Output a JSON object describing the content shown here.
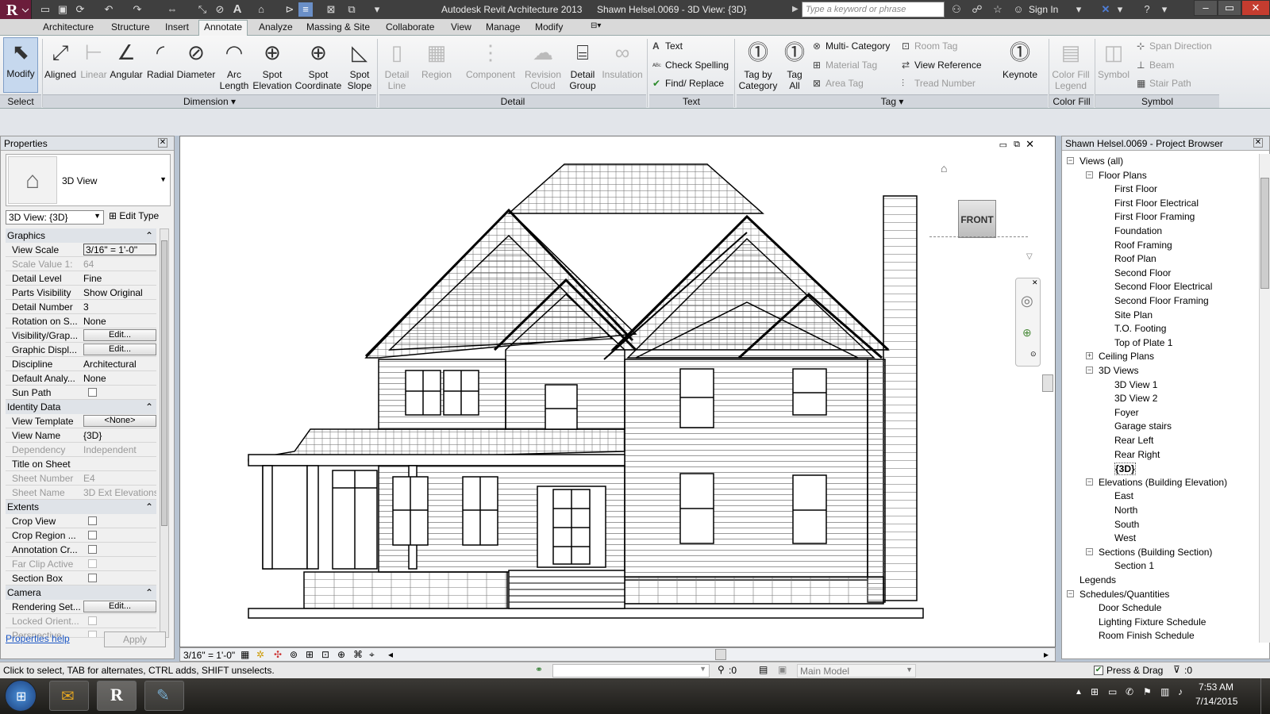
{
  "title": {
    "app": "Autodesk Revit Architecture 2013",
    "doc": "Shawn Helsel.0069 - 3D View: {3D}",
    "search_placeholder": "Type a keyword or phrase",
    "sign_in": "Sign In"
  },
  "tabs": [
    "Architecture",
    "Structure",
    "Insert",
    "Annotate",
    "Analyze",
    "Massing & Site",
    "Collaborate",
    "View",
    "Manage",
    "Modify"
  ],
  "active_tab": "Annotate",
  "ribbon": {
    "modify": "Modify",
    "select": "Select",
    "dimension": [
      "Aligned",
      "Linear",
      "Angular",
      "Radial",
      "Diameter",
      "Arc Length",
      "Spot Elevation",
      "Spot Coordinate",
      "Spot Slope"
    ],
    "dimension_label": "Dimension",
    "detail": [
      "Detail Line",
      "Region",
      "Component",
      "Revision Cloud",
      "Detail Group",
      "Insulation"
    ],
    "detail_label": "Detail",
    "text": [
      "Text",
      "Check Spelling",
      "Find/ Replace"
    ],
    "text_label": "Text",
    "tag_big": [
      "Tag by Category",
      "Tag All"
    ],
    "tag_small": [
      "Multi- Category",
      "Material Tag",
      "Area Tag",
      "Room Tag",
      "View Reference",
      "Tread Number"
    ],
    "keynote": "Keynote",
    "tag_label": "Tag",
    "color_fill": "Color Fill Legend",
    "color_fill_label": "Color Fill",
    "symbol": [
      "Symbol",
      "Span Direction",
      "Beam",
      "Stair Path"
    ],
    "symbol_label": "Symbol"
  },
  "properties": {
    "title": "Properties",
    "type": "3D View",
    "selector": "3D View: {3D}",
    "edit_type": "Edit Type",
    "groups": {
      "graphics": "Graphics",
      "identity": "Identity Data",
      "extents": "Extents",
      "camera": "Camera"
    },
    "rows": [
      {
        "k": "View Scale",
        "v": "3/16\" = 1'-0\""
      },
      {
        "k": "Scale Value    1:",
        "v": "64"
      },
      {
        "k": "Detail Level",
        "v": "Fine"
      },
      {
        "k": "Parts Visibility",
        "v": "Show Original"
      },
      {
        "k": "Detail Number",
        "v": "3"
      },
      {
        "k": "Rotation on S...",
        "v": "None"
      },
      {
        "k": "Visibility/Grap...",
        "v": "Edit..."
      },
      {
        "k": "Graphic Displ...",
        "v": "Edit..."
      },
      {
        "k": "Discipline",
        "v": "Architectural"
      },
      {
        "k": "Default Analy...",
        "v": "None"
      },
      {
        "k": "Sun Path",
        "v": ""
      },
      {
        "k": "View Template",
        "v": "<None>"
      },
      {
        "k": "View Name",
        "v": "{3D}"
      },
      {
        "k": "Dependency",
        "v": "Independent"
      },
      {
        "k": "Title on Sheet",
        "v": ""
      },
      {
        "k": "Sheet Number",
        "v": "E4"
      },
      {
        "k": "Sheet Name",
        "v": "3D Ext Elevations"
      },
      {
        "k": "Crop View",
        "v": ""
      },
      {
        "k": "Crop Region ...",
        "v": ""
      },
      {
        "k": "Annotation Cr...",
        "v": ""
      },
      {
        "k": "Far Clip Active",
        "v": ""
      },
      {
        "k": "Section Box",
        "v": ""
      },
      {
        "k": "Rendering Set...",
        "v": "Edit..."
      },
      {
        "k": "Locked Orient...",
        "v": ""
      },
      {
        "k": "Perspective",
        "v": ""
      }
    ],
    "help": "Properties help",
    "apply": "Apply"
  },
  "view": {
    "cube_label": "FRONT",
    "scale": "3/16\" = 1'-0\""
  },
  "browser": {
    "title": "Shawn Helsel.0069 - Project Browser",
    "items": [
      {
        "t": "Views (all)",
        "lvl": 0
      },
      {
        "t": "Floor Plans",
        "lvl": 1
      },
      {
        "t": "First Floor",
        "lvl": 2
      },
      {
        "t": "First Floor Electrical",
        "lvl": 2
      },
      {
        "t": "First Floor Framing",
        "lvl": 2
      },
      {
        "t": "Foundation",
        "lvl": 2
      },
      {
        "t": "Roof Framing",
        "lvl": 2
      },
      {
        "t": "Roof Plan",
        "lvl": 2
      },
      {
        "t": "Second Floor",
        "lvl": 2
      },
      {
        "t": "Second Floor Electrical",
        "lvl": 2
      },
      {
        "t": "Second Floor Framing",
        "lvl": 2
      },
      {
        "t": "Site Plan",
        "lvl": 2
      },
      {
        "t": "T.O. Footing",
        "lvl": 2
      },
      {
        "t": "Top of Plate 1",
        "lvl": 2
      },
      {
        "t": "Ceiling Plans",
        "lvl": 1
      },
      {
        "t": "3D Views",
        "lvl": 1
      },
      {
        "t": "3D View 1",
        "lvl": 2
      },
      {
        "t": "3D View 2",
        "lvl": 2
      },
      {
        "t": "Foyer",
        "lvl": 2
      },
      {
        "t": "Garage stairs",
        "lvl": 2
      },
      {
        "t": "Rear Left",
        "lvl": 2
      },
      {
        "t": "Rear Right",
        "lvl": 2
      },
      {
        "t": "{3D}",
        "lvl": 2
      },
      {
        "t": "Elevations (Building Elevation)",
        "lvl": 1
      },
      {
        "t": "East",
        "lvl": 2
      },
      {
        "t": "North",
        "lvl": 2
      },
      {
        "t": "South",
        "lvl": 2
      },
      {
        "t": "West",
        "lvl": 2
      },
      {
        "t": "Sections (Building Section)",
        "lvl": 1
      },
      {
        "t": "Section 1",
        "lvl": 2
      },
      {
        "t": "Legends",
        "lvl": 0
      },
      {
        "t": "Schedules/Quantities",
        "lvl": 0
      },
      {
        "t": "Door Schedule",
        "lvl": 1
      },
      {
        "t": "Lighting Fixture Schedule",
        "lvl": 1
      },
      {
        "t": "Room Finish Schedule",
        "lvl": 1
      }
    ]
  },
  "status": {
    "hint": "Click to select, TAB for alternates, CTRL adds, SHIFT unselects.",
    "count": ":0",
    "model": "Main Model",
    "press_drag": "Press & Drag",
    "filter": ":0"
  },
  "taskbar": {
    "time": "7:53 AM",
    "date": "7/14/2015"
  }
}
